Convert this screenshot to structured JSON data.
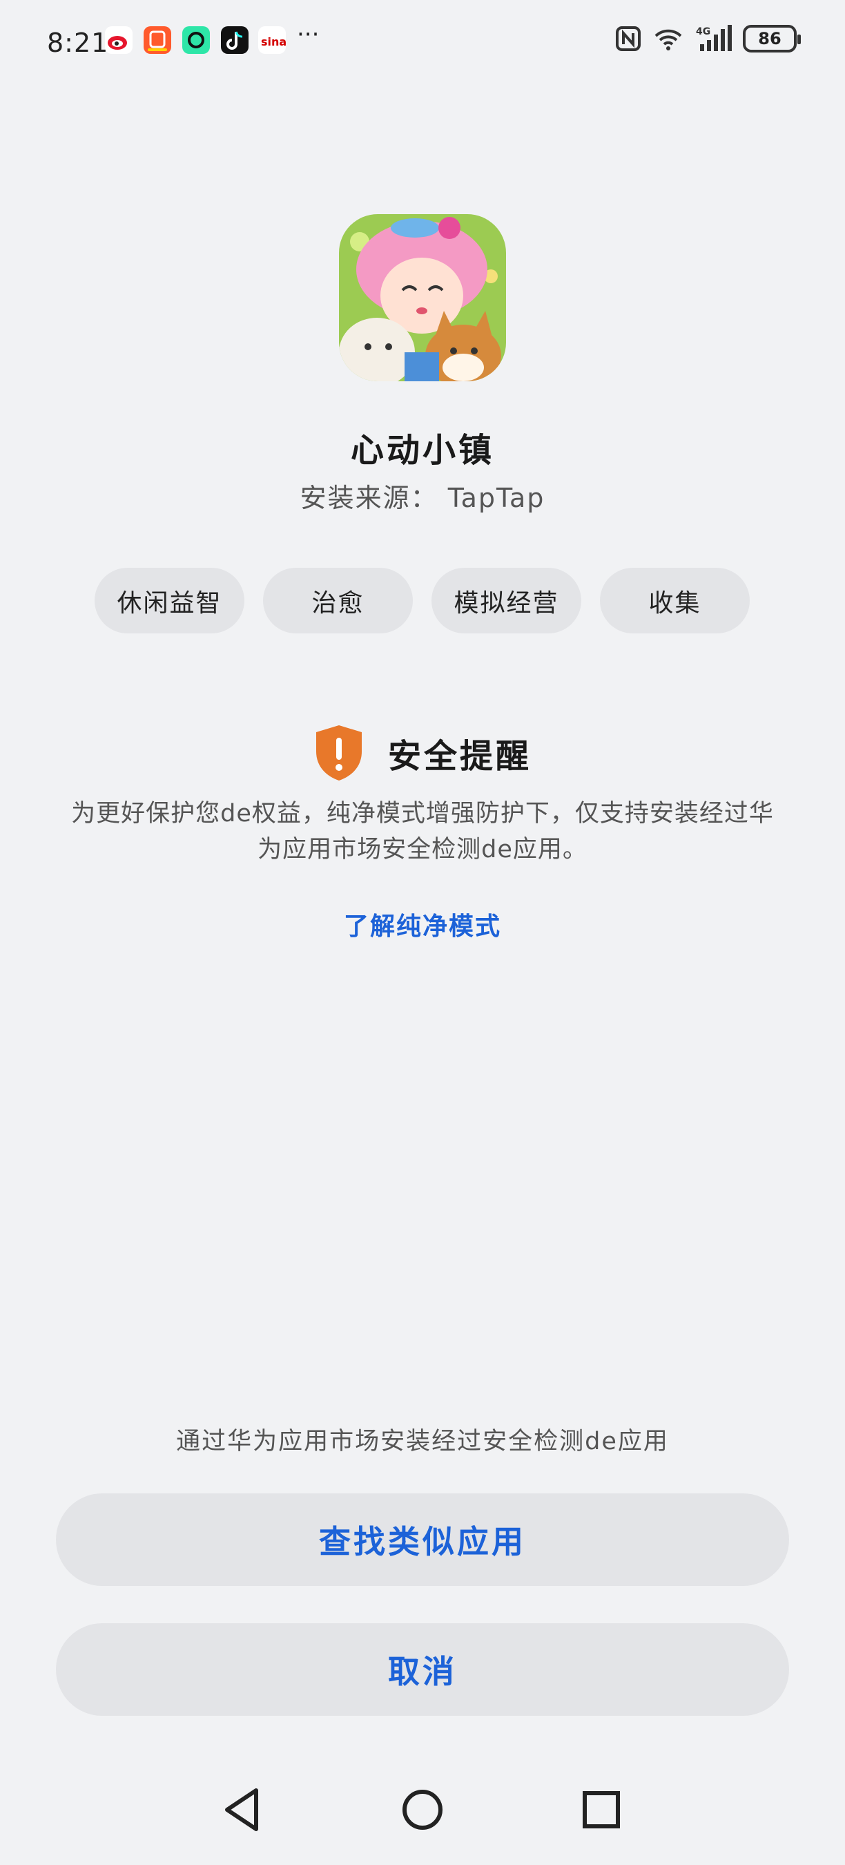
{
  "status_bar": {
    "time": "8:21",
    "more": "···",
    "battery": "86",
    "notification_icons": [
      "weibo-icon",
      "kuaishou-icon",
      "app-icon",
      "tiktok-icon",
      "sina-icon"
    ],
    "system_icons": [
      "nfc-icon",
      "wifi-icon",
      "signal-4g-icon",
      "battery-icon"
    ]
  },
  "app": {
    "name": "心动小镇",
    "source": "安装来源：  TapTap",
    "tags": [
      "休闲益智",
      "治愈",
      "模拟经营",
      "收集"
    ]
  },
  "security": {
    "title": "安全提醒",
    "description": "为更好保护您de权益，纯净模式增强防护下，仅支持安装经过华为应用市场安全检测de应用。",
    "learn_more": "了解纯净模式",
    "accent_color": "#e8782a"
  },
  "bottom": {
    "hint": "通过华为应用市场安装经过安全检测de应用",
    "find_similar_button": "查找类似应用",
    "cancel_button": "取消",
    "button_text_color": "#1c62d8"
  }
}
